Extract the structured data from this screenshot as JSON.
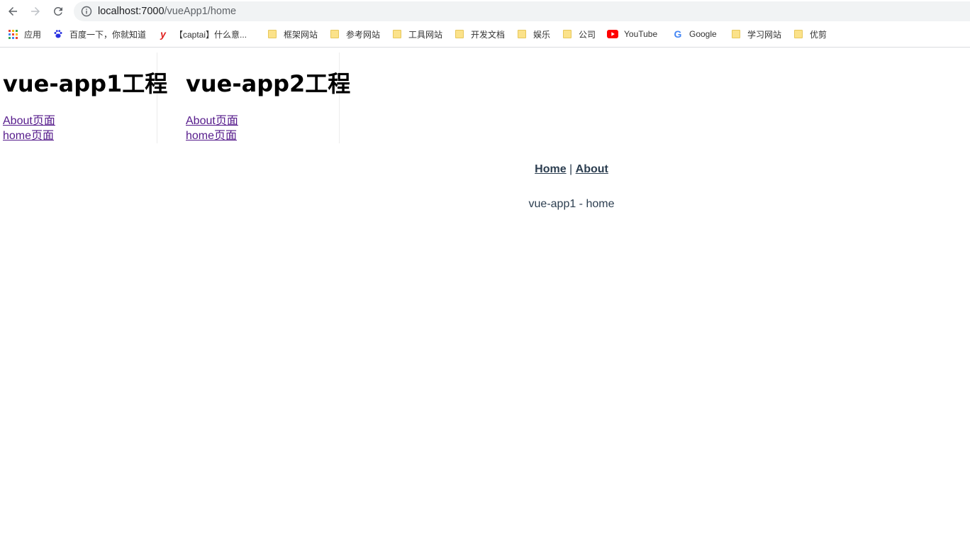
{
  "browser": {
    "url_host": "localhost:7000",
    "url_path": "/vueApp1/home"
  },
  "bookmarks": [
    {
      "label": "应用",
      "icon": "apps-grid-icon"
    },
    {
      "label": "百度一下，你就知道",
      "icon": "baidu-paw-icon"
    },
    {
      "label": "【captai】什么意...",
      "icon": "youdao-y-icon"
    },
    {
      "label": "框架网站",
      "icon": "folder-icon"
    },
    {
      "label": "参考网站",
      "icon": "folder-icon"
    },
    {
      "label": "工具网站",
      "icon": "folder-icon"
    },
    {
      "label": "开发文档",
      "icon": "folder-icon"
    },
    {
      "label": "娱乐",
      "icon": "folder-icon"
    },
    {
      "label": "公司",
      "icon": "folder-icon"
    },
    {
      "label": "YouTube",
      "icon": "youtube-icon"
    },
    {
      "label": "Google",
      "icon": "google-icon"
    },
    {
      "label": "学习网站",
      "icon": "folder-icon"
    },
    {
      "label": "优剪",
      "icon": "folder-icon"
    }
  ],
  "apps": [
    {
      "title": "vue-app1工程",
      "links": [
        "About页面",
        "home页面"
      ]
    },
    {
      "title": "vue-app2工程",
      "links": [
        "About页面",
        "home页面"
      ]
    }
  ],
  "subapp": {
    "nav_home": "Home",
    "nav_separator": "|",
    "nav_about": "About",
    "view_text": "vue-app1 - home"
  },
  "colors": {
    "link_visited": "#551a8b",
    "vue_text": "#2c3e50",
    "omnibox_bg": "#f1f3f4"
  }
}
